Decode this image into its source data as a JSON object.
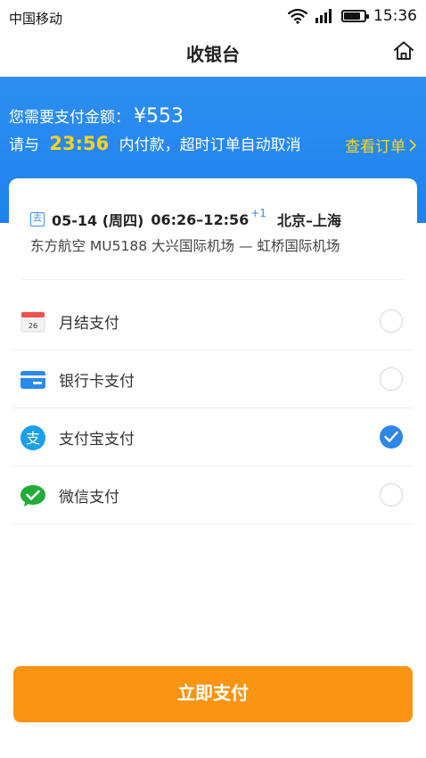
{
  "status_bar": {
    "carrier": "中国移动",
    "time": "15:36",
    "battery_level": 0.8,
    "icons": [
      "wifi-icon",
      "signal-icon",
      "battery-icon"
    ]
  },
  "nav": {
    "title": "收银台",
    "right_icon": "home-icon"
  },
  "banner": {
    "amount_label": "您需要支付金额：",
    "amount": "¥553",
    "time_prefix": "请与",
    "countdown": "23:56",
    "time_suffix": "内付款，超时订单自动取消",
    "view_order_label": "查看订单",
    "view_order_icon": "chevron-right-icon"
  },
  "flight": {
    "direction_badge": "去",
    "date": "05-14 (周四)",
    "time_range": "06:26–12:56",
    "day_offset": "+1",
    "route": "北京–上海",
    "details": "东方航空 MU5188   大兴国际机场 — 虹桥国际机场"
  },
  "payment_methods": [
    {
      "label": "月结支付",
      "icon": "calendar-icon",
      "calendar_day": "26",
      "selected": false
    },
    {
      "label": "银行卡支付",
      "icon": "bank-card-icon",
      "selected": false
    },
    {
      "label": "支付宝支付",
      "icon": "alipay-icon",
      "icon_glyph": "支",
      "selected": true
    },
    {
      "label": "微信支付",
      "icon": "wechat-pay-icon",
      "selected": false
    }
  ],
  "colors": {
    "banner_blue": "#1e82ee",
    "countdown_yellow": "#ffd21f",
    "pay_button_orange": "#fb9412",
    "selected_blue": "#2e86e6"
  },
  "pay_button": {
    "label": "立即支付"
  }
}
